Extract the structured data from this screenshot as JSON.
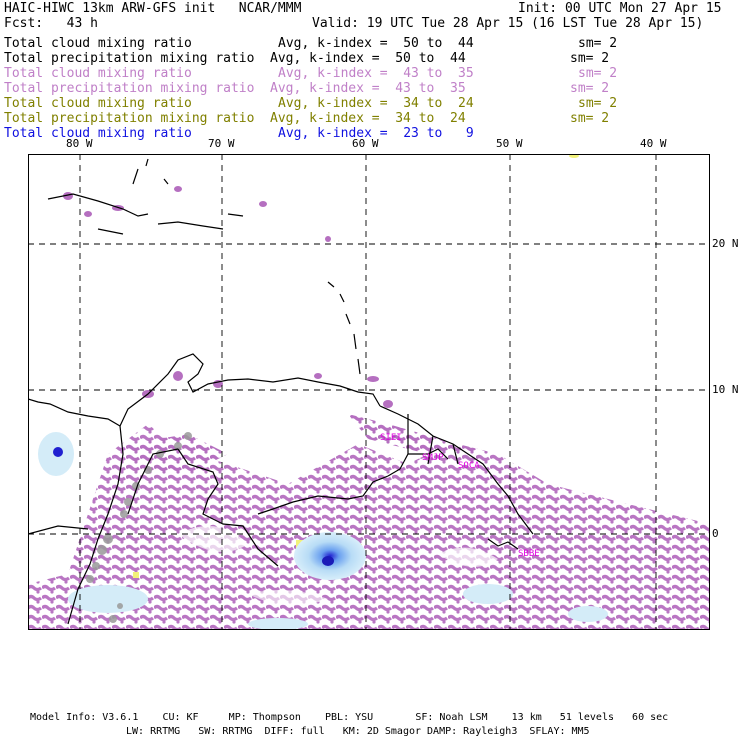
{
  "header": {
    "title": "HAIC-HIWC 13km ARW-GFS init   NCAR/MMM",
    "init": "Init: 00 UTC Mon 27 Apr 15",
    "fcst": "Fcst:   43 h",
    "valid": "Valid: 19 UTC Tue 28 Apr 15 (16 LST Tue 28 Apr 15)"
  },
  "fields": [
    {
      "label": "Total cloud mixing ratio",
      "range": "Avg, k-index =  50 to  44",
      "sm": "sm= 2",
      "color": "#000000"
    },
    {
      "label": "Total precipitation mixing ratio",
      "range": "Avg, k-index =  50 to  44",
      "sm": "sm= 2",
      "color": "#000000"
    },
    {
      "label": "Total cloud mixing ratio",
      "range": "Avg, k-index =  43 to  35",
      "sm": "sm= 2",
      "color": "#c080c8"
    },
    {
      "label": "Total precipitation mixing ratio",
      "range": "Avg, k-index =  43 to  35",
      "sm": "sm= 2",
      "color": "#c080c8"
    },
    {
      "label": "Total cloud mixing ratio",
      "range": "Avg, k-index =  34 to  24",
      "sm": "sm= 2",
      "color": "#808000"
    },
    {
      "label": "Total precipitation mixing ratio",
      "range": "Avg, k-index =  34 to  24",
      "sm": "sm= 2",
      "color": "#808000"
    },
    {
      "label": "Total cloud mixing ratio",
      "range": "Avg, k-index =  23 to   9",
      "sm": "",
      "color": "#1010e0"
    }
  ],
  "map": {
    "lon_labels": [
      "80 W",
      "70 W",
      "60 W",
      "50 W",
      "40 W"
    ],
    "lat_labels": [
      "20 N",
      "10 N",
      "0"
    ],
    "stations": [
      "SIEI",
      "SMJP",
      "SOCA",
      "SBBE"
    ],
    "colors": {
      "precip_purple": "#b56fc0",
      "cloud_light_blue": "#d4ecf8",
      "cloud_blue": "#2020d0",
      "gray": "#9a9a9a",
      "yellow": "#f2f27a",
      "station": "#e000e0"
    }
  },
  "footer": {
    "line1": "Model Info: V3.6.1    CU: KF     MP: Thompson    PBL: YSU       SF: Noah LSM    13 km   51 levels   60 sec",
    "line2": "LW: RRTMG   SW: RRTMG  DIFF: full   KM: 2D Smagor DAMP: Rayleigh3  SFLAY: MM5"
  }
}
